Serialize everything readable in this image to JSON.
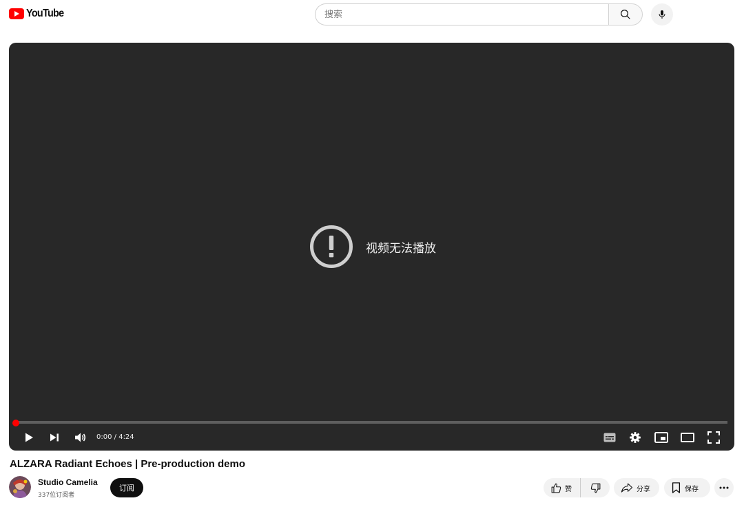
{
  "header": {
    "logo_text": "YouTube",
    "search": {
      "placeholder": "搜索",
      "value": ""
    }
  },
  "player": {
    "error_message": "视频无法播放",
    "time_current": "0:00",
    "time_separator": " / ",
    "time_total": "4:24",
    "progress": 0,
    "accent_color": "#ff0000"
  },
  "video": {
    "title": "ALZARA Radiant Echoes | Pre-production demo",
    "channel_name": "Studio Camelia",
    "subscriber_count": "337位订阅者",
    "subscribe_label": "订阅"
  },
  "actions": {
    "like_label": "赞",
    "share_label": "分享",
    "save_label": "保存"
  },
  "icons": [
    "youtube-logo-icon",
    "search-icon",
    "microphone-icon",
    "alert-circle-icon",
    "play-icon",
    "skip-next-icon",
    "volume-icon",
    "subtitles-icon",
    "settings-gear-icon",
    "miniplayer-icon",
    "theater-mode-icon",
    "fullscreen-icon",
    "thumb-up-icon",
    "thumb-down-icon",
    "share-arrow-icon",
    "bookmark-icon",
    "more-dots-icon"
  ]
}
